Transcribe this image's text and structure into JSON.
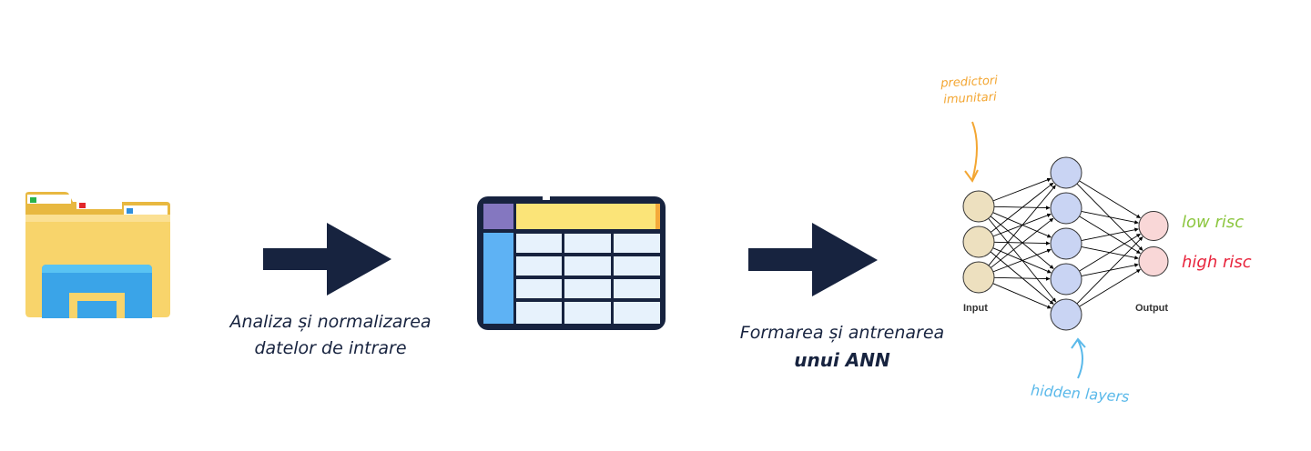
{
  "steps": {
    "step1_caption": [
      "Analiza și normalizarea",
      "datelor de intrare"
    ],
    "step2_caption": [
      "Formarea și antrenarea",
      "unui ANN"
    ]
  },
  "network": {
    "input_label": "Input",
    "output_label": "Output",
    "layers": [
      3,
      5,
      2
    ],
    "colors": {
      "input": "#ede0bf",
      "hidden": "#c9d4f3",
      "output": "#f9d7d7",
      "edge": "#000000"
    }
  },
  "annotations": {
    "predictors": [
      "predictori",
      "imunitari"
    ],
    "hidden_layers": "hidden layers",
    "low_risk": "low risc",
    "high_risk": "high risc"
  },
  "colors": {
    "arrow": "#17233f",
    "predictors_note": "#f3a632",
    "hidden_note": "#5ab9ea",
    "low_risk": "#8cc63f",
    "high_risk": "#e8243c"
  },
  "icons": [
    "folder-icon",
    "arrow-right-icon",
    "table-icon",
    "arrow-right-icon",
    "neural-network-icon"
  ]
}
